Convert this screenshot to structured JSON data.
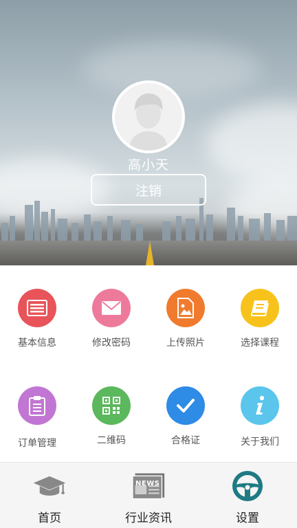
{
  "profile": {
    "username": "高小天",
    "logout_label": "注销"
  },
  "grid": {
    "items": [
      {
        "label": "基本信息",
        "icon": "id-card-icon",
        "color": "#e8545a"
      },
      {
        "label": "修改密码",
        "icon": "envelope-icon",
        "color": "#ee7a9b"
      },
      {
        "label": "上传照片",
        "icon": "image-file-icon",
        "color": "#f07b2e"
      },
      {
        "label": "选择课程",
        "icon": "book-icon",
        "color": "#f7c21b"
      },
      {
        "label": "订单管理",
        "icon": "clipboard-icon",
        "color": "#c276d3"
      },
      {
        "label": "二维码",
        "icon": "qr-code-icon",
        "color": "#5cb85c"
      },
      {
        "label": "合格证",
        "icon": "checkmark-icon",
        "color": "#2e8be6"
      },
      {
        "label": "关于我们",
        "icon": "info-icon",
        "color": "#5bc5ec"
      }
    ]
  },
  "tabbar": {
    "items": [
      {
        "label": "首页",
        "icon": "graduation-cap-icon"
      },
      {
        "label": "行业资讯",
        "icon": "newspaper-icon",
        "icon_text": "NEWS"
      },
      {
        "label": "设置",
        "icon": "steering-wheel-icon"
      }
    ]
  }
}
